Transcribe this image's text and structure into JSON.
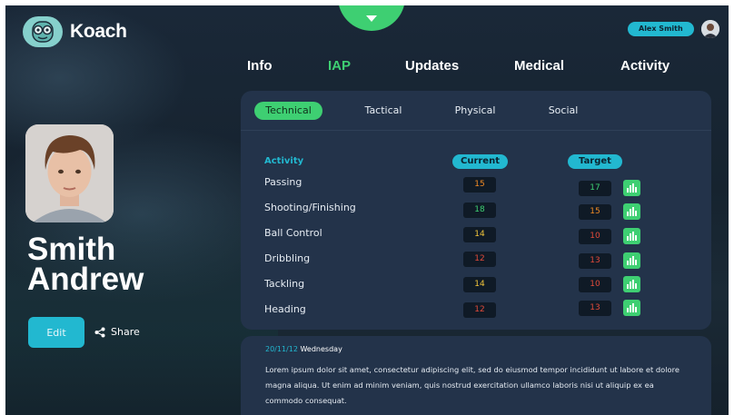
{
  "app": {
    "name": "Koach"
  },
  "user": {
    "name": "Alex Smith"
  },
  "nav": {
    "items": [
      "Info",
      "IAP",
      "Updates",
      "Medical",
      "Activity"
    ],
    "active": "IAP"
  },
  "profile": {
    "first_name": "Smith",
    "last_name": "Andrew",
    "edit_label": "Edit",
    "share_label": "Share"
  },
  "subtabs": {
    "items": [
      "Technical",
      "Tactical",
      "Physical",
      "Social"
    ],
    "active": "Technical"
  },
  "table": {
    "headers": {
      "activity": "Activity",
      "current": "Current",
      "target": "Target"
    },
    "rows": [
      {
        "activity": "Passing",
        "current": "15",
        "target": "17"
      },
      {
        "activity": "Shooting/Finishing",
        "current": "18",
        "target": "15"
      },
      {
        "activity": "Ball Control",
        "current": "14",
        "target": "10"
      },
      {
        "activity": "Dribbling",
        "current": "12",
        "target": "13"
      },
      {
        "activity": "Tackling",
        "current": "14",
        "target": "10"
      },
      {
        "activity": "Heading",
        "current": "12",
        "target": "13"
      }
    ],
    "value_colors": [
      "#f08a24",
      "#3ecf72",
      "#f0c43a",
      "#e14a3a"
    ]
  },
  "note": {
    "date": "20/11/12",
    "day": "Wednesday",
    "text": "Lorem ipsum dolor sit amet, consectetur adipiscing elit, sed do eiusmod tempor incididunt ut labore et dolore magna aliqua. Ut enim ad minim veniam, quis nostrud exercitation ullamco laboris nisi ut aliquip ex ea commodo consequat."
  },
  "colors": {
    "accent_green": "#3ecf72",
    "accent_cyan": "#22b8d0",
    "card": "#23334a"
  },
  "icons": [
    "koach-logo-icon",
    "chevron-down-icon",
    "share-icon",
    "bar-chart-icon",
    "user-avatar-icon"
  ]
}
